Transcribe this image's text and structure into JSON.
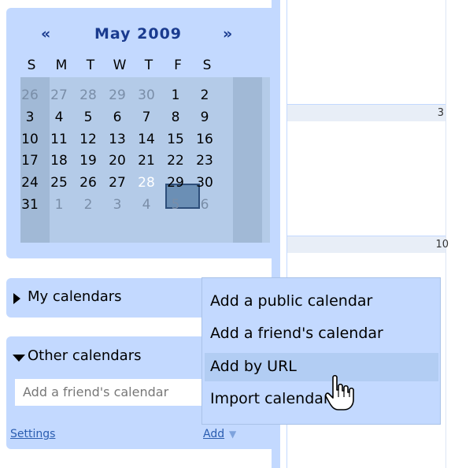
{
  "mini_calendar": {
    "prev": "«",
    "next": "»",
    "month_title": "May 2009",
    "weekdays": [
      "S",
      "M",
      "T",
      "W",
      "T",
      "F",
      "S"
    ],
    "weeks": [
      [
        "26",
        "27",
        "28",
        "29",
        "30",
        "1",
        "2"
      ],
      [
        "3",
        "4",
        "5",
        "6",
        "7",
        "8",
        "9"
      ],
      [
        "10",
        "11",
        "12",
        "13",
        "14",
        "15",
        "16"
      ],
      [
        "17",
        "18",
        "19",
        "20",
        "21",
        "22",
        "23"
      ],
      [
        "24",
        "25",
        "26",
        "27",
        "28",
        "29",
        "30"
      ],
      [
        "31",
        "1",
        "2",
        "3",
        "4",
        "5",
        "6"
      ]
    ],
    "selected": "28"
  },
  "grid": {
    "day_3": "3",
    "day_10": "10"
  },
  "my_calendars": {
    "label": "My calendars"
  },
  "other_calendars": {
    "label": "Other calendars",
    "input_placeholder": "Add a friend's calendar",
    "settings": "Settings",
    "add": "Add"
  },
  "add_menu": {
    "items": [
      "Add a public calendar",
      "Add a friend's calendar",
      "Add by URL",
      "Import calendar"
    ]
  },
  "colors": {
    "panel": "#c3d9ff",
    "link": "#2a5db0"
  }
}
